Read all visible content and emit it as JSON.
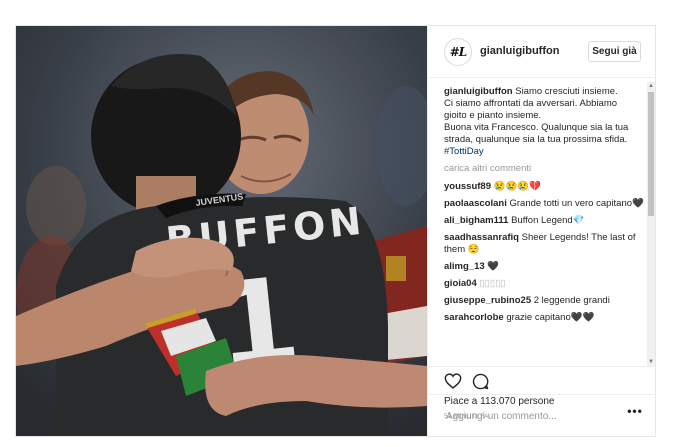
{
  "post": {
    "username": "gianluigibuffon",
    "avatar_text": "#L",
    "follow_label": "Segui già",
    "photo": {
      "jersey_name": "BUFFON",
      "jersey_number": "1",
      "collar_text": "JUVENTUS"
    },
    "caption": {
      "username": "gianluigibuffon",
      "lines": [
        "Siamo cresciuti insieme.",
        "Ci siamo affrontati da avversari. Abbiamo",
        "gioito e pianto insieme.",
        "Buona vita Francesco. Qualunque sia la tua",
        "strada, qualunque sia la tua prossima sfida."
      ],
      "hashtag": "#TottiDay"
    },
    "load_more": "carica altri commenti",
    "comments": [
      {
        "user": "youssuf89",
        "text": "😢😢😢💔"
      },
      {
        "user": "paolaascolani",
        "text": "Grande totti un vero capitano🖤"
      },
      {
        "user": "ali_bigham111",
        "text": "Buffon Legend💎"
      },
      {
        "user": "saadhassanrafiq",
        "text": "Sheer Legends! The last of them 😌"
      },
      {
        "user": "alimg_13",
        "text": "🖤"
      },
      {
        "user": "gioia04",
        "text": "▯▯▯▯▯"
      },
      {
        "user": "giuseppe_rubino25",
        "text": "2 leggende grandi"
      },
      {
        "user": "sarahcorlobe",
        "text": "grazie capitano🖤🖤"
      }
    ],
    "likes": "Piace a 113.070 persone",
    "time": "51 MINUTI FA",
    "add_comment_placeholder": "Aggiungi un commento...",
    "more_label": "•••"
  }
}
